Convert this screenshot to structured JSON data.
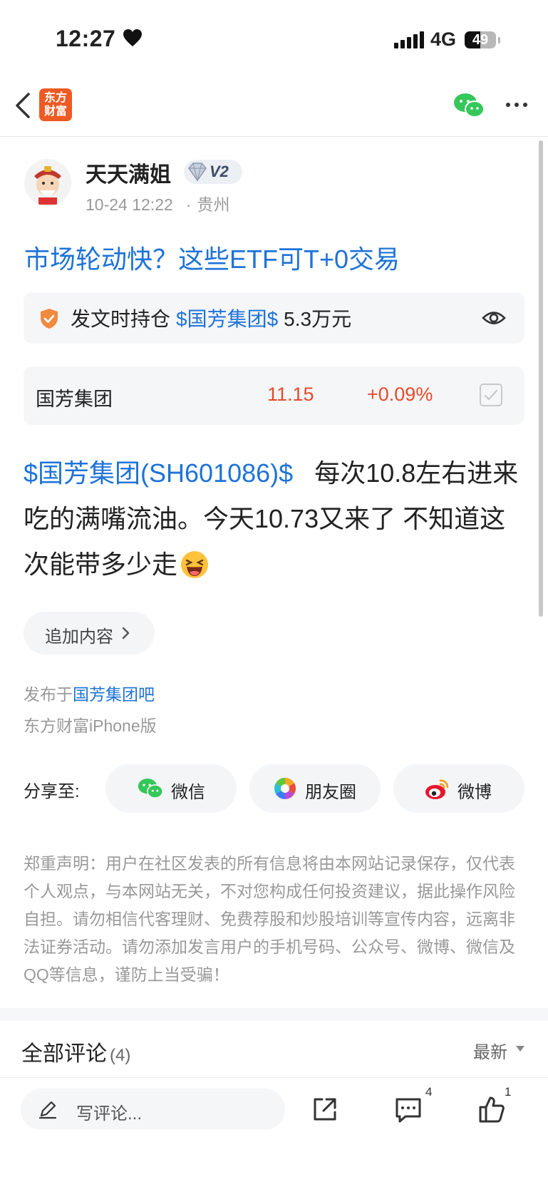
{
  "status_bar": {
    "time": "12:27",
    "network": "4G",
    "battery": "49",
    "battery_level": 0.49
  },
  "nav": {
    "logo_line1": "东方",
    "logo_line2": "财富"
  },
  "author": {
    "name": "天天满姐",
    "level": "V2",
    "date": "10-24 12:22",
    "dot": "·",
    "location": "贵州"
  },
  "post": {
    "title": "市场轮动快？这些ETF可T+0交易",
    "holding": {
      "label": "发文时持仓",
      "stock": "$国芳集团$",
      "amount": "5.3万元"
    },
    "quote": {
      "name": "国芳集团",
      "price": "11.15",
      "change": "+0.09%"
    },
    "body_stock": "$国芳集团(SH601086)$",
    "body_text": "每次10.8左右进来吃的满嘴流油。今天10.73又来了 不知道这次能带多少走",
    "add_content": "追加内容",
    "published_prefix": "发布于",
    "published_bar": "国芳集团吧",
    "client": "东方财富iPhone版"
  },
  "share": {
    "label": "分享至:",
    "wechat": "微信",
    "moments": "朋友圈",
    "weibo": "微博"
  },
  "disclaimer": "郑重声明：用户在社区发表的所有信息将由本网站记录保存，仅代表个人观点，与本网站无关，不对您构成任何投资建议，据此操作风险自担。请勿相信代客理财、免费荐股和炒股培训等宣传内容，远离非法证券活动。请勿添加发言用户的手机号码、公众号、微博、微信及QQ等信息，谨防上当受骗！",
  "comments": {
    "title": "全部评论",
    "count": "(4)",
    "sort": "最新"
  },
  "bottom_bar": {
    "placeholder": "写评论...",
    "comment_count": "4",
    "like_count": "1"
  },
  "colors": {
    "accent_blue": "#1e73d8",
    "rise_red": "#e8492b",
    "brand_orange": "#ee5a24",
    "wechat_green": "#34c759"
  }
}
